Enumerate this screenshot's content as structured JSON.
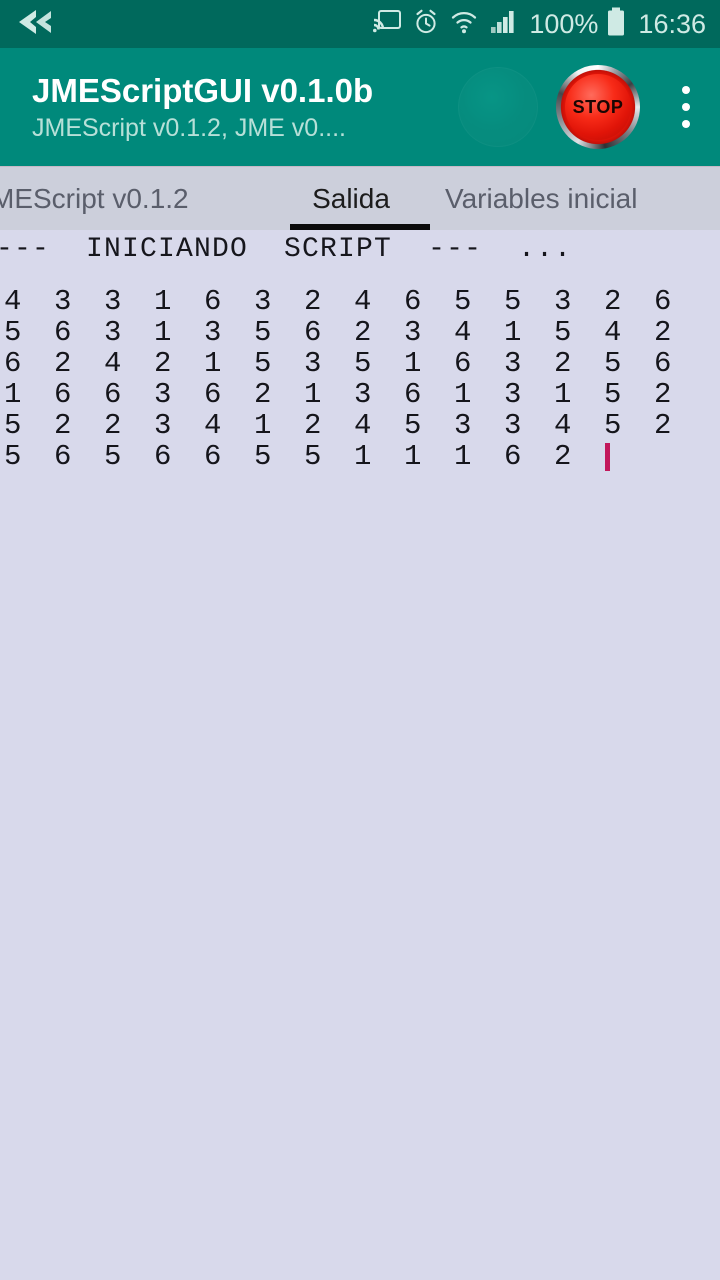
{
  "status_bar": {
    "back_icon": "back-arrow-icon",
    "icons": [
      "cast-icon",
      "alarm-icon",
      "wifi-icon",
      "signal-icon"
    ],
    "battery_percent": "100%",
    "battery_icon": "battery-full-icon",
    "clock": "16:36"
  },
  "app_bar": {
    "title": "JMEScriptGUI v0.1.0b",
    "subtitle": "JMEScript v0.1.2, JME v0....",
    "run_button_label": "",
    "stop_button_label": "STOP",
    "overflow_label": "",
    "accent_color": "#00897B",
    "status_bar_color": "#00695C"
  },
  "tabs": [
    {
      "label": "MEScript v0.1.2",
      "active": false
    },
    {
      "label": "Salida",
      "active": true
    },
    {
      "label": "Variables inicial",
      "active": false
    }
  ],
  "console": {
    "header": "---  INICIANDO  SCRIPT  ---  ...",
    "cursor_color": "#C2185B",
    "background_color": "#D8D9EB",
    "text_color": "#15151B",
    "rows": [
      [
        "4",
        "3",
        "3",
        "1",
        "6",
        "3",
        "2",
        "4",
        "6",
        "5",
        "5",
        "3",
        "2",
        "6"
      ],
      [
        "5",
        "6",
        "3",
        "1",
        "3",
        "5",
        "6",
        "2",
        "3",
        "4",
        "1",
        "5",
        "4",
        "2"
      ],
      [
        "6",
        "2",
        "4",
        "2",
        "1",
        "5",
        "3",
        "5",
        "1",
        "6",
        "3",
        "2",
        "5",
        "6"
      ],
      [
        "1",
        "6",
        "6",
        "3",
        "6",
        "2",
        "1",
        "3",
        "6",
        "1",
        "3",
        "1",
        "5",
        "2"
      ],
      [
        "5",
        "2",
        "2",
        "3",
        "4",
        "1",
        "2",
        "4",
        "5",
        "3",
        "3",
        "4",
        "5",
        "2"
      ],
      [
        "5",
        "6",
        "5",
        "6",
        "6",
        "5",
        "5",
        "1",
        "1",
        "1",
        "6",
        "2"
      ]
    ]
  }
}
